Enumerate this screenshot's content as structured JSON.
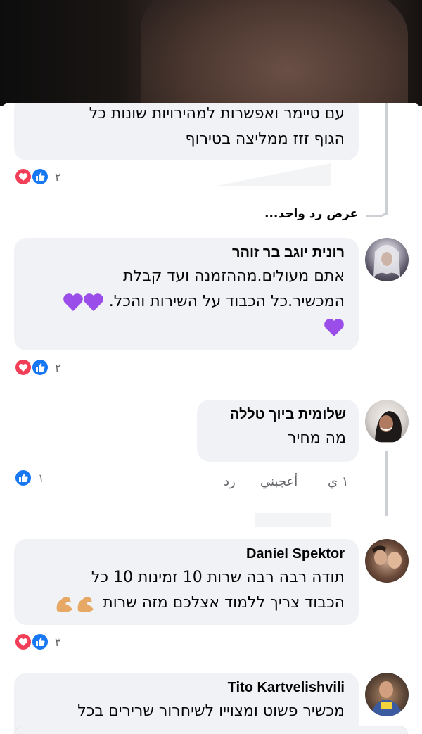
{
  "comments": [
    {
      "id": "c1",
      "text_lines": [
        "עם טיימר ואפשרות למהירויות שונות כל",
        "הגוף זזז ממליצה בטירוף"
      ],
      "reaction_count": "٢"
    },
    {
      "id": "reply-link",
      "label": "عرض رد واحد..."
    },
    {
      "id": "c2",
      "author": "רונית יוגב בר זוהר",
      "text_lines": [
        "אתם מעולים.מההזמנה ועד קבלת",
        "המכשיר.כל הכבוד על השירות והכל."
      ],
      "reaction_count": "٢"
    },
    {
      "id": "c3",
      "author": "שלומית ביוך טללה",
      "text": "מה מחיר",
      "reaction_count": "١",
      "actions": {
        "time": "١ ي",
        "like": "أعجبني",
        "reply": "رد"
      }
    },
    {
      "id": "c4",
      "author": "Daniel Spektor",
      "text_lines": [
        "תודה רבה רבה שרות 10 זמינות 10 כל",
        "הכבוד צריך ללמוד אצלכם מזה שרות"
      ],
      "reaction_count": "٣"
    },
    {
      "id": "c5",
      "author": "Tito Kartvelishvili",
      "text": "מכשיר פשוט ומצוייו לשיחרור שרירים בכל"
    }
  ],
  "colors": {
    "bubble": "#f0f2f5",
    "love": "#f33e58",
    "like": "#1877f2",
    "purple_heart": "#9b4dea"
  },
  "icons": [
    "heart-reaction-icon",
    "like-reaction-icon",
    "purple-heart-emoji",
    "flexed-biceps-emoji"
  ]
}
